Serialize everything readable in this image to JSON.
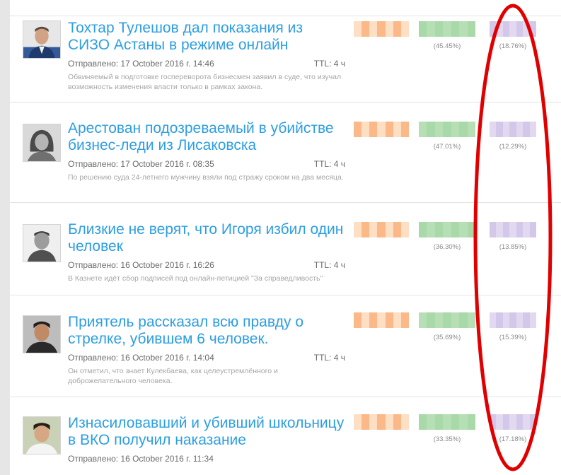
{
  "layout_colors": {
    "orange": [
      "#fde0c4",
      "#fcc79d",
      "#ffdcbd",
      "#fbb888",
      "#fdd2ae",
      "#fcbf92"
    ],
    "green": [
      "#cfe8cf",
      "#a9d8a9",
      "#c4e4c4",
      "#9dd19d",
      "#b6dfb6",
      "#d3ebd3"
    ],
    "purple": [
      "#ddd3ee",
      "#c1b1e3",
      "#d4c8ea",
      "#a996d8",
      "#cbbbe6",
      "#e2d9f1"
    ]
  },
  "accent": {
    "link": "#2c9ee3",
    "ellipse": "#e00000"
  },
  "news": [
    {
      "title": "Тохтар Тулешов дал показания из СИЗО Астаны в режиме онлайн",
      "sent": "Отправлено: 17 October 2016 г. 14:46",
      "ttl": "TTL: 4 ч",
      "description": "Обвиняемый в подготовке госпереворота бизнесмен заявил в суде, что изучал возможность изменения власти только в рамках закона.",
      "pct_green": "(45.45%)",
      "pct_purple": "(18.76%)",
      "avatar": "avatar-man-suit"
    },
    {
      "title": "Арестован подозреваемый в убийстве бизнес-леди из Лисаковска",
      "sent": "Отправлено: 17 October 2016 г. 08:35",
      "ttl": "TTL: 4 ч",
      "description": "По решению суда 24-летнего мужчину взяли под стражу сроком на два месяца.",
      "pct_green": "(47.01%)",
      "pct_purple": "(12.29%)",
      "avatar": "avatar-woman-bw"
    },
    {
      "title": "Близкие не верят, что Игоря избил один человек",
      "sent": "Отправлено: 16 October 2016 г. 16:26",
      "ttl": "TTL: 4 ч",
      "description": "В Казнете идёт сбор подписей под онлайн-петицией \"За справедливость\"",
      "pct_green": "(36.30%)",
      "pct_purple": "(13.85%)",
      "avatar": "avatar-man-bw"
    },
    {
      "title": "Приятель рассказал всю правду о стрелке, убившем 6 человек.",
      "sent": "Отправлено: 16 October 2016 г. 14:04",
      "ttl": "TTL: 4 ч",
      "description": "Он отметил, что знает Кулекбаева, как целеустремлённого и доброжелательного человека.",
      "pct_green": "(35.69%)",
      "pct_purple": "(15.39%)",
      "avatar": "avatar-man-dark"
    },
    {
      "title": "Изнасиловавший и убивший школьницу в ВКО получил наказание",
      "sent": "Отправлено: 16 October 2016 г. 11:34",
      "ttl": "",
      "description": "",
      "pct_green": "(33.35%)",
      "pct_purple": "(17.18%)",
      "avatar": "avatar-man-young"
    }
  ]
}
